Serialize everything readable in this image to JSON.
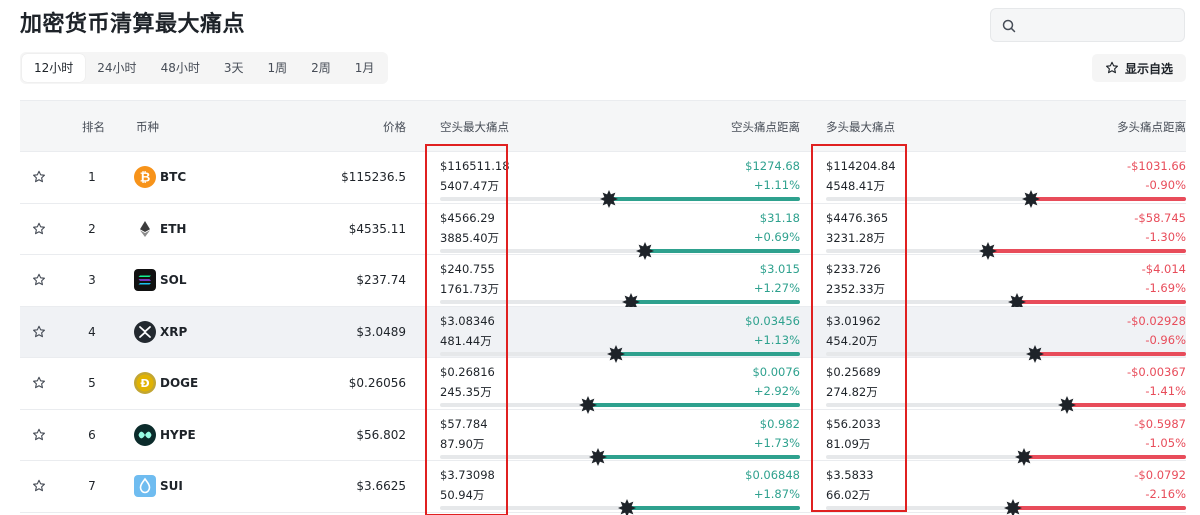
{
  "page": {
    "title": "加密货币清算最大痛点"
  },
  "search": {
    "placeholder": ""
  },
  "tabs": [
    "12小时",
    "24小时",
    "48小时",
    "3天",
    "1周",
    "2周",
    "1月"
  ],
  "active_tab": "12小时",
  "toolbar": {
    "favorites_label": "显示自选"
  },
  "table": {
    "headers": {
      "rank": "排名",
      "coin": "币种",
      "price": "价格",
      "short_pain": "空头最大痛点",
      "short_distance": "空头痛点距离",
      "long_pain": "多头最大痛点",
      "long_distance": "多头痛点距离"
    },
    "rows": [
      {
        "rank": "1",
        "coin": "BTC",
        "icon": "bitcoin-icon",
        "icon_color": "#f7931a",
        "price": "$115236.5",
        "short_price": "$116511.18",
        "short_vol": "5407.47万",
        "short_dist": "$1274.68",
        "short_pct": "+1.11%",
        "short_bar": 0.53,
        "long_price": "$114204.84",
        "long_vol": "4548.41万",
        "long_dist": "-$1031.66",
        "long_pct": "-0.90%",
        "long_bar": 0.43
      },
      {
        "rank": "2",
        "coin": "ETH",
        "icon": "ethereum-icon",
        "icon_color": "#3c3c3d",
        "price": "$4535.11",
        "short_price": "$4566.29",
        "short_vol": "3885.40万",
        "short_dist": "$31.18",
        "short_pct": "+0.69%",
        "short_bar": 0.43,
        "long_price": "$4476.365",
        "long_vol": "3231.28万",
        "long_dist": "-$58.745",
        "long_pct": "-1.30%",
        "long_bar": 0.55
      },
      {
        "rank": "3",
        "coin": "SOL",
        "icon": "solana-icon",
        "icon_color": "#111111",
        "price": "$237.74",
        "short_price": "$240.755",
        "short_vol": "1761.73万",
        "short_dist": "$3.015",
        "short_pct": "+1.27%",
        "short_bar": 0.47,
        "long_price": "$233.726",
        "long_vol": "2352.33万",
        "long_dist": "-$4.014",
        "long_pct": "-1.69%",
        "long_bar": 0.47
      },
      {
        "rank": "4",
        "coin": "XRP",
        "icon": "xrp-icon",
        "icon_color": "#23292f",
        "price": "$3.0489",
        "short_price": "$3.08346",
        "short_vol": "481.44万",
        "short_dist": "$0.03456",
        "short_pct": "+1.13%",
        "short_bar": 0.51,
        "long_price": "$3.01962",
        "long_vol": "454.20万",
        "long_dist": "-$0.02928",
        "long_pct": "-0.96%",
        "long_bar": 0.42
      },
      {
        "rank": "5",
        "coin": "DOGE",
        "icon": "dogecoin-icon",
        "icon_color": "#c2a633",
        "price": "$0.26056",
        "short_price": "$0.26816",
        "short_vol": "245.35万",
        "short_dist": "$0.0076",
        "short_pct": "+2.92%",
        "short_bar": 0.59,
        "long_price": "$0.25689",
        "long_vol": "274.82万",
        "long_dist": "-$0.00367",
        "long_pct": "-1.41%",
        "long_bar": 0.33
      },
      {
        "rank": "6",
        "coin": "HYPE",
        "icon": "hyperliquid-icon",
        "icon_color": "#0b2b2b",
        "price": "$56.802",
        "short_price": "$57.784",
        "short_vol": "87.90万",
        "short_dist": "$0.982",
        "short_pct": "+1.73%",
        "short_bar": 0.56,
        "long_price": "$56.2033",
        "long_vol": "81.09万",
        "long_dist": "-$0.5987",
        "long_pct": "-1.05%",
        "long_bar": 0.45
      },
      {
        "rank": "7",
        "coin": "SUI",
        "icon": "sui-icon",
        "icon_color": "#6fbcf0",
        "price": "$3.6625",
        "short_price": "$3.73098",
        "short_vol": "50.94万",
        "short_dist": "$0.06848",
        "short_pct": "+1.87%",
        "short_bar": 0.48,
        "long_price": "$3.5833",
        "long_vol": "66.02万",
        "long_dist": "-$0.0792",
        "long_pct": "-2.16%",
        "long_bar": 0.48
      }
    ]
  },
  "colors": {
    "positive": "#2ea18e",
    "negative": "#e84c5a",
    "highlight_box": "#e02020"
  }
}
